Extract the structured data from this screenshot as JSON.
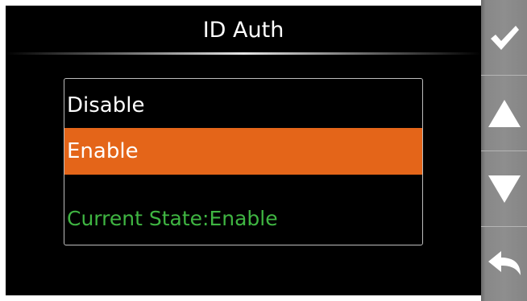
{
  "screen": {
    "title": "ID Auth"
  },
  "options": [
    {
      "label": "Disable",
      "selected": false
    },
    {
      "label": "Enable",
      "selected": true
    }
  ],
  "status": {
    "text": "Current State:Enable"
  },
  "sidebar": {
    "buttons": [
      {
        "name": "confirm",
        "icon": "checkmark-icon"
      },
      {
        "name": "up",
        "icon": "arrow-up-icon"
      },
      {
        "name": "down",
        "icon": "arrow-down-icon"
      },
      {
        "name": "back",
        "icon": "back-arrow-icon"
      }
    ]
  },
  "colors": {
    "selection": "#e46519",
    "status_text": "#3fb542",
    "screen_background": "#000000",
    "sidebar": "#8e8e8e"
  }
}
